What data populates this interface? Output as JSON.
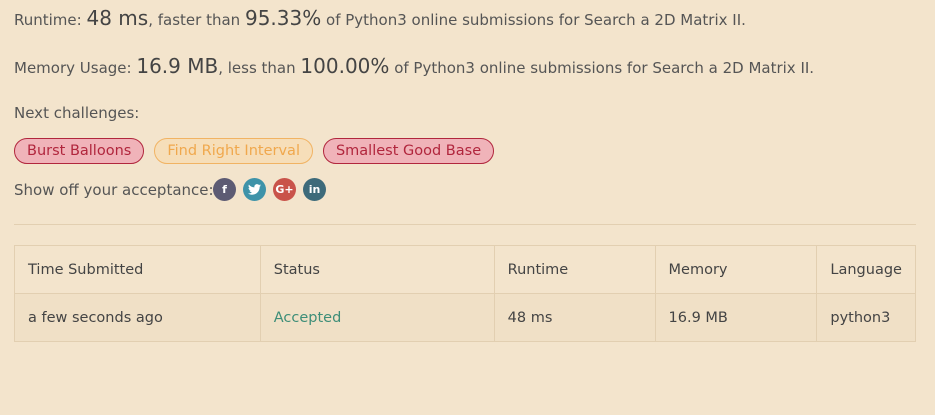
{
  "runtime": {
    "label": "Runtime:",
    "value": "48 ms",
    "mid": ", faster than",
    "percent": "95.33%",
    "suffix": "of Python3 online submissions for Search a 2D Matrix II."
  },
  "memory": {
    "label": "Memory Usage:",
    "value": "16.9 MB",
    "mid": ", less than",
    "percent": "100.00%",
    "suffix": "of Python3 online submissions for Search a 2D Matrix II."
  },
  "next_challenges": {
    "label": "Next challenges:",
    "items": [
      {
        "label": "Burst Balloons",
        "difficulty": "hard"
      },
      {
        "label": "Find Right Interval",
        "difficulty": "medium"
      },
      {
        "label": "Smallest Good Base",
        "difficulty": "hard"
      }
    ]
  },
  "share": {
    "label": "Show off your acceptance:",
    "icons": [
      {
        "name": "facebook-icon",
        "glyph": "f"
      },
      {
        "name": "twitter-icon",
        "glyph": "t"
      },
      {
        "name": "google-plus-icon",
        "glyph": "G+"
      },
      {
        "name": "linkedin-icon",
        "glyph": "in"
      }
    ]
  },
  "table": {
    "headers": [
      "Time Submitted",
      "Status",
      "Runtime",
      "Memory",
      "Language"
    ],
    "rows": [
      {
        "time": "a few seconds ago",
        "status": "Accepted",
        "runtime": "48 ms",
        "memory": "16.9 MB",
        "language": "python3"
      }
    ]
  },
  "colors": {
    "background": "#f3e4cc",
    "hard": "#b1263d",
    "medium": "#f0a84d",
    "accepted": "#3e8e78"
  }
}
